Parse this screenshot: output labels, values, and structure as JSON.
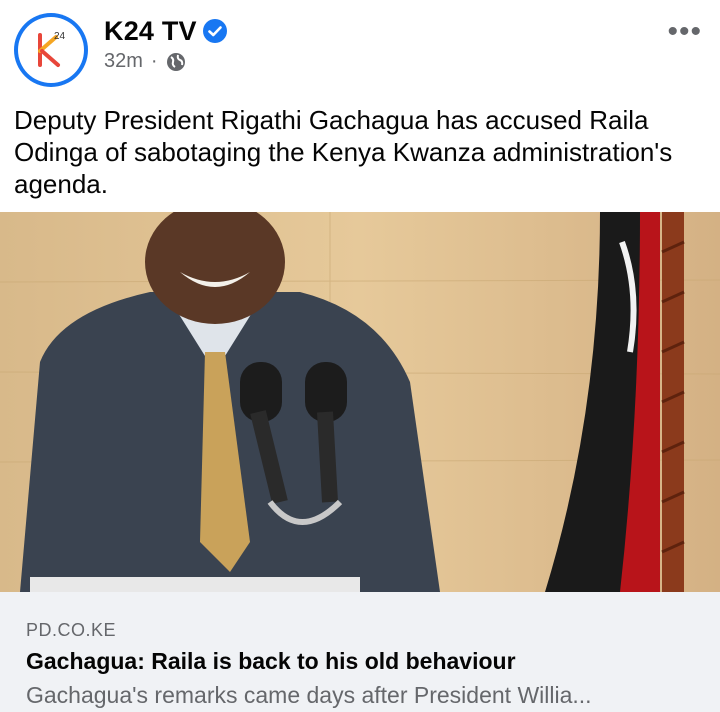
{
  "post": {
    "page_name": "K24 TV",
    "time": "32m",
    "separator": "·",
    "more_label": "•••",
    "text": "Deputy President Rigathi Gachagua has accused Raila Odinga of sabotaging the Kenya Kwanza administration's agenda."
  },
  "avatar": {
    "logo_text": "24"
  },
  "link": {
    "domain": "PD.CO.KE",
    "headline": "Gachagua: Raila is back to his old behaviour",
    "description": "Gachagua's remarks came days after President Willia..."
  },
  "colors": {
    "brand": "#1877f2",
    "secondary_text": "#65676b",
    "card_bg": "#f0f2f5"
  },
  "icons": {
    "verified": "verified-badge-icon",
    "audience": "globe-icon",
    "menu": "more-options-icon"
  }
}
